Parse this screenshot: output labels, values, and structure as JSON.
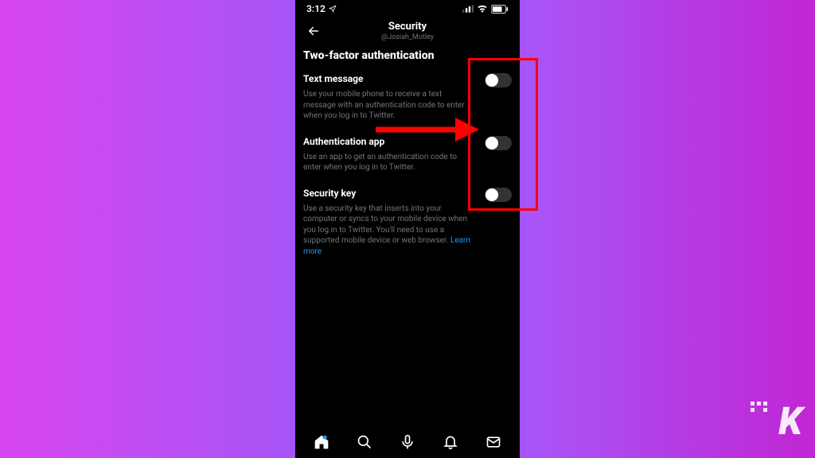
{
  "status": {
    "time": "3:12"
  },
  "header": {
    "title": "Security",
    "subtitle": "@Josiah_Motley"
  },
  "section": {
    "title": "Two-factor authentication"
  },
  "options": [
    {
      "title": "Text message",
      "desc": "Use your mobile phone to receive a text message with an authentication code to enter when you log in to Twitter."
    },
    {
      "title": "Authentication app",
      "desc": "Use an app to get an authentication code to enter when you log in to Twitter."
    },
    {
      "title": "Security key",
      "desc": "Use a security key that inserts into your computer or syncs to your mobile device when you log in to Twitter. You'll need to use a supported mobile device or web browser."
    }
  ],
  "learn_more": "Learn more",
  "watermark": "K"
}
